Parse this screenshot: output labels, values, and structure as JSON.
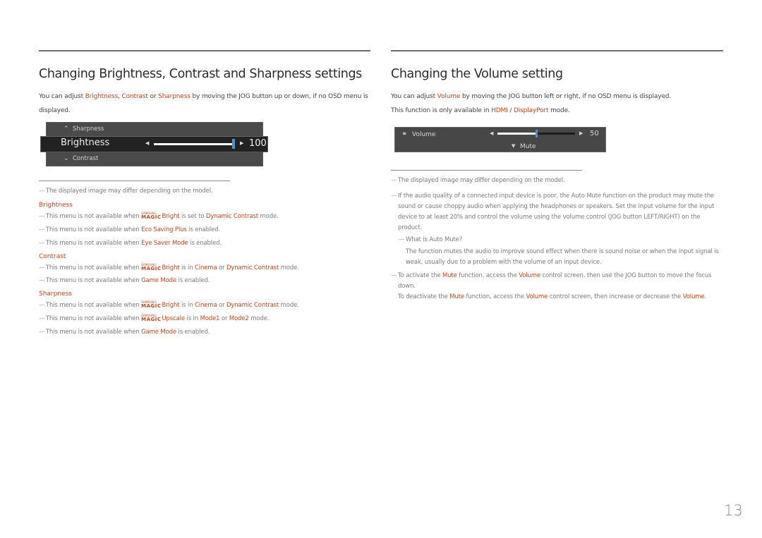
{
  "left": {
    "title": "Changing Brightness, Contrast and Sharpness settings",
    "intro": {
      "t1": "You can adjust ",
      "k1": "Brightness",
      "t2": ", ",
      "k2": "Contrast",
      "t3": " or ",
      "k3": "Sharpness",
      "t4": " by moving the JOG button up or down, if no OSD menu is displayed."
    },
    "osd": {
      "above_label": "Sharpness",
      "selected_label": "Brightness",
      "selected_value": "100",
      "selected_fraction": 1.0,
      "below_label": "Contrast"
    },
    "note_image": "The displayed image may differ depending on the model.",
    "sections": {
      "brightness": {
        "heading": "Brightness",
        "n1": {
          "a": "This menu is not available when ",
          "brand_s": "SAMSUNG",
          "brand_m": "MAGIC",
          "k1": "Bright",
          "b": " is set to ",
          "k2": "Dynamic Contrast",
          "c": " mode."
        },
        "n2": {
          "a": "This menu is not available when ",
          "k1": "Eco Saving Plus",
          "b": " is enabled."
        },
        "n3": {
          "a": "This menu is not available when ",
          "k1": "Eye Saver Mode",
          "b": " is enabled."
        }
      },
      "contrast": {
        "heading": "Contrast",
        "n1": {
          "a": "This menu is not available when ",
          "brand_s": "SAMSUNG",
          "brand_m": "MAGIC",
          "k1": "Bright",
          "b": " is in ",
          "k2": "Cinema",
          "c": " or ",
          "k3": "Dynamic Contrast",
          "d": " mode."
        },
        "n2": {
          "a": "This menu is not available when ",
          "k1": "Game Mode",
          "b": " is enabled."
        }
      },
      "sharpness": {
        "heading": "Sharpness",
        "n1": {
          "a": "This menu is not available when ",
          "brand_s": "SAMSUNG",
          "brand_m": "MAGIC",
          "k1": "Bright",
          "b": " is in ",
          "k2": "Cinema",
          "c": " or ",
          "k3": "Dynamic Contrast",
          "d": " mode."
        },
        "n2": {
          "a": "This menu is not available when ",
          "brand_s": "SAMSUNG",
          "brand_m": "MAGIC",
          "k1": "Upscale",
          "b": " is in ",
          "k2": "Mode1",
          "c": " or ",
          "k3": "Mode2",
          "d": " mode."
        },
        "n3": {
          "a": "This menu is not available when ",
          "k1": "Game Mode",
          "b": " is enabled."
        }
      }
    }
  },
  "right": {
    "title": "Changing the Volume setting",
    "intro1": {
      "a": "You can adjust ",
      "k1": "Volume",
      "b": " by moving the JOG button left or right, if no OSD menu is displayed."
    },
    "intro2": {
      "a": "This function is only available in ",
      "k1": "HDMI",
      "b": " / ",
      "k2": "DisplayPort",
      "c": " mode."
    },
    "osd": {
      "label": "Volume",
      "value": "50",
      "fraction": 0.5,
      "mute_label": "Mute"
    },
    "note_image": "The displayed image may differ depending on the model.",
    "note_audio": {
      "a": "If the audio quality of a connected input device is poor, the Auto Mute function on the product may mute the sound or cause choppy audio when applying the headphones or speakers. Set the input volume for the input device to at least 20% and control the volume using the volume control (JOG button ",
      "k1": "LEFT/RIGHT",
      "b": ") on the product."
    },
    "note_auto_mute_q": "What is Auto Mute?",
    "note_auto_mute_a": "The function mutes the audio to improve sound effect when there is sound noise or when the input signal is weak, usually due to a problem with the volume of an input device.",
    "note_mute": {
      "a": "To activate the ",
      "k1": "Mute",
      "b": " function, access the ",
      "k2": "Volume",
      "c": " control screen, then use the JOG button to move the focus down."
    },
    "note_unmute": {
      "a": "To deactivate the ",
      "k1": "Mute",
      "b": " function, access the ",
      "k2": "Volume",
      "c": " control screen, then increase or decrease the ",
      "k3": "Volume",
      "d": "."
    }
  },
  "page_number": "13",
  "colors": {
    "accent": "#c0461d",
    "slider_thumb": "#4d90d8",
    "osd_bg": "#474747"
  }
}
